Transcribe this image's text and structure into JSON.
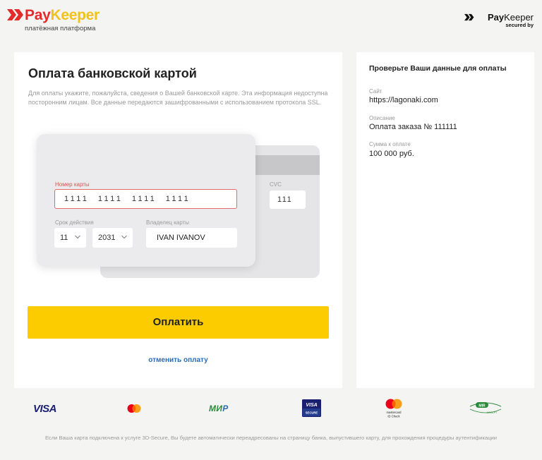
{
  "header": {
    "brand_pay": "Pay",
    "brand_keeper": "Keeper",
    "tagline": "платёжная платформа",
    "secured_brand_pay": "Pay",
    "secured_brand_keeper": "Keeper",
    "secured_by": "secured by"
  },
  "payment": {
    "title": "Оплата банковской картой",
    "intro": "Для оплаты укажите, пожалуйста, сведения о Вашей банковской карте. Эта информация недоступна посторонним лицам. Все данные передаются зашифрованными с использованием протокола SSL.",
    "card_number_label": "Номер карты",
    "card_number_value": "1111  1111  1111  1111",
    "expiry_label": "Срок действия",
    "expiry_month": "11",
    "expiry_year": "2031",
    "owner_label": "Владелец карты",
    "owner_value": "IVAN IVANOV",
    "cvc_label": "CVC",
    "cvc_value": "111",
    "pay_button": "Оплатить",
    "cancel_link": "отменить оплату"
  },
  "summary": {
    "title": "Проверьте Ваши данные для оплаты",
    "site_label": "Сайт",
    "site_value": "https://lagonaki.com",
    "description_label": "Описание",
    "description_value": "Оплата заказа № 111111",
    "amount_label": "Сумма к оплате",
    "amount_value": "100 000 руб."
  },
  "payment_systems": {
    "visa": "VISA",
    "mir_m": "МИ",
    "mir_r": "Р",
    "visa_secure_top": "VISA",
    "visa_secure_bottom": "SECURE",
    "mc_idcheck_line1": "mastercard",
    "mc_idcheck_line2": "ID Check",
    "mir_accept": "MIR",
    "mir_accept_sub": "ACCEPT",
    "icons": [
      "visa-logo",
      "mastercard-logo",
      "mir-logo",
      "visa-secure-logo",
      "mastercard-id-check-logo",
      "mir-accept-logo"
    ]
  },
  "footer": {
    "note": "Если Ваша карта подключена к услуге 3D-Secure, Вы будете автоматически переадресованы на страницу банка, выпустившего карту, для прохождения процедуры аутентификации"
  },
  "colors": {
    "accent_red": "#e22b2b",
    "accent_yellow": "#f1c21b",
    "pay_button": "#fccc00",
    "link": "#2a6bb0",
    "background": "#f4f4f2"
  }
}
